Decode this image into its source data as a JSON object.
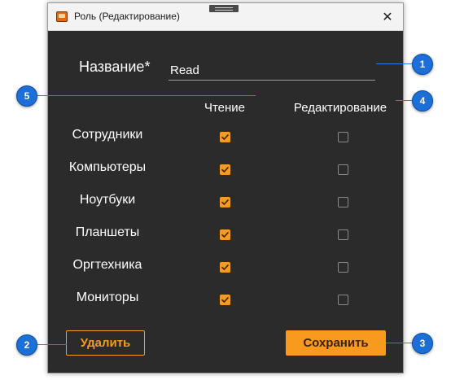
{
  "window": {
    "title": "Роль (Редактирование)",
    "close_glyph": "✕"
  },
  "form": {
    "name_label": "Название*",
    "name_value": "Read"
  },
  "columns": {
    "read": "Чтение",
    "edit": "Редактирование"
  },
  "rows": [
    {
      "label": "Сотрудники",
      "read": true,
      "edit": false
    },
    {
      "label": "Компьютеры",
      "read": true,
      "edit": false
    },
    {
      "label": "Ноутбуки",
      "read": true,
      "edit": false
    },
    {
      "label": "Планшеты",
      "read": true,
      "edit": false
    },
    {
      "label": "Оргтехника",
      "read": true,
      "edit": false
    },
    {
      "label": "Мониторы",
      "read": true,
      "edit": false
    }
  ],
  "buttons": {
    "delete": "Удалить",
    "save": "Сохранить"
  },
  "callouts": [
    "1",
    "2",
    "3",
    "4",
    "5"
  ],
  "colors": {
    "accent": "#f79a1d",
    "background": "#2b2b2b",
    "callout": "#1b6fd6"
  }
}
